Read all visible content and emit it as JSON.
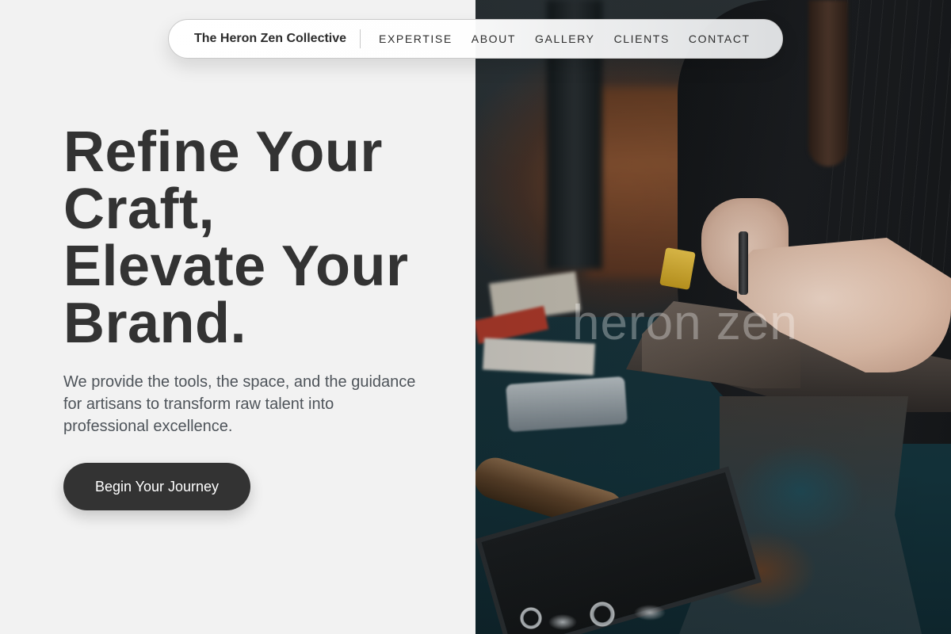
{
  "nav": {
    "brand": "The Heron Zen Collective",
    "links": [
      "EXPERTISE",
      "ABOUT",
      "GALLERY",
      "CLIENTS",
      "CONTACT"
    ]
  },
  "hero": {
    "title_lines": [
      "Refine Your",
      "Craft,",
      "Elevate Your",
      "Brand."
    ],
    "subtitle": "We provide the tools, the space, and the guidance for artisans to transform raw talent into professional excellence.",
    "cta_label": "Begin Your Journey"
  },
  "image": {
    "subject": "artisan-hands-working-on-anvil-photo",
    "watermark": "heron zen"
  },
  "colors": {
    "background": "#f2f2f2",
    "text_dark": "#333333",
    "text_muted": "#4e545a",
    "button_bg": "#333333",
    "button_text": "#ffffff"
  }
}
